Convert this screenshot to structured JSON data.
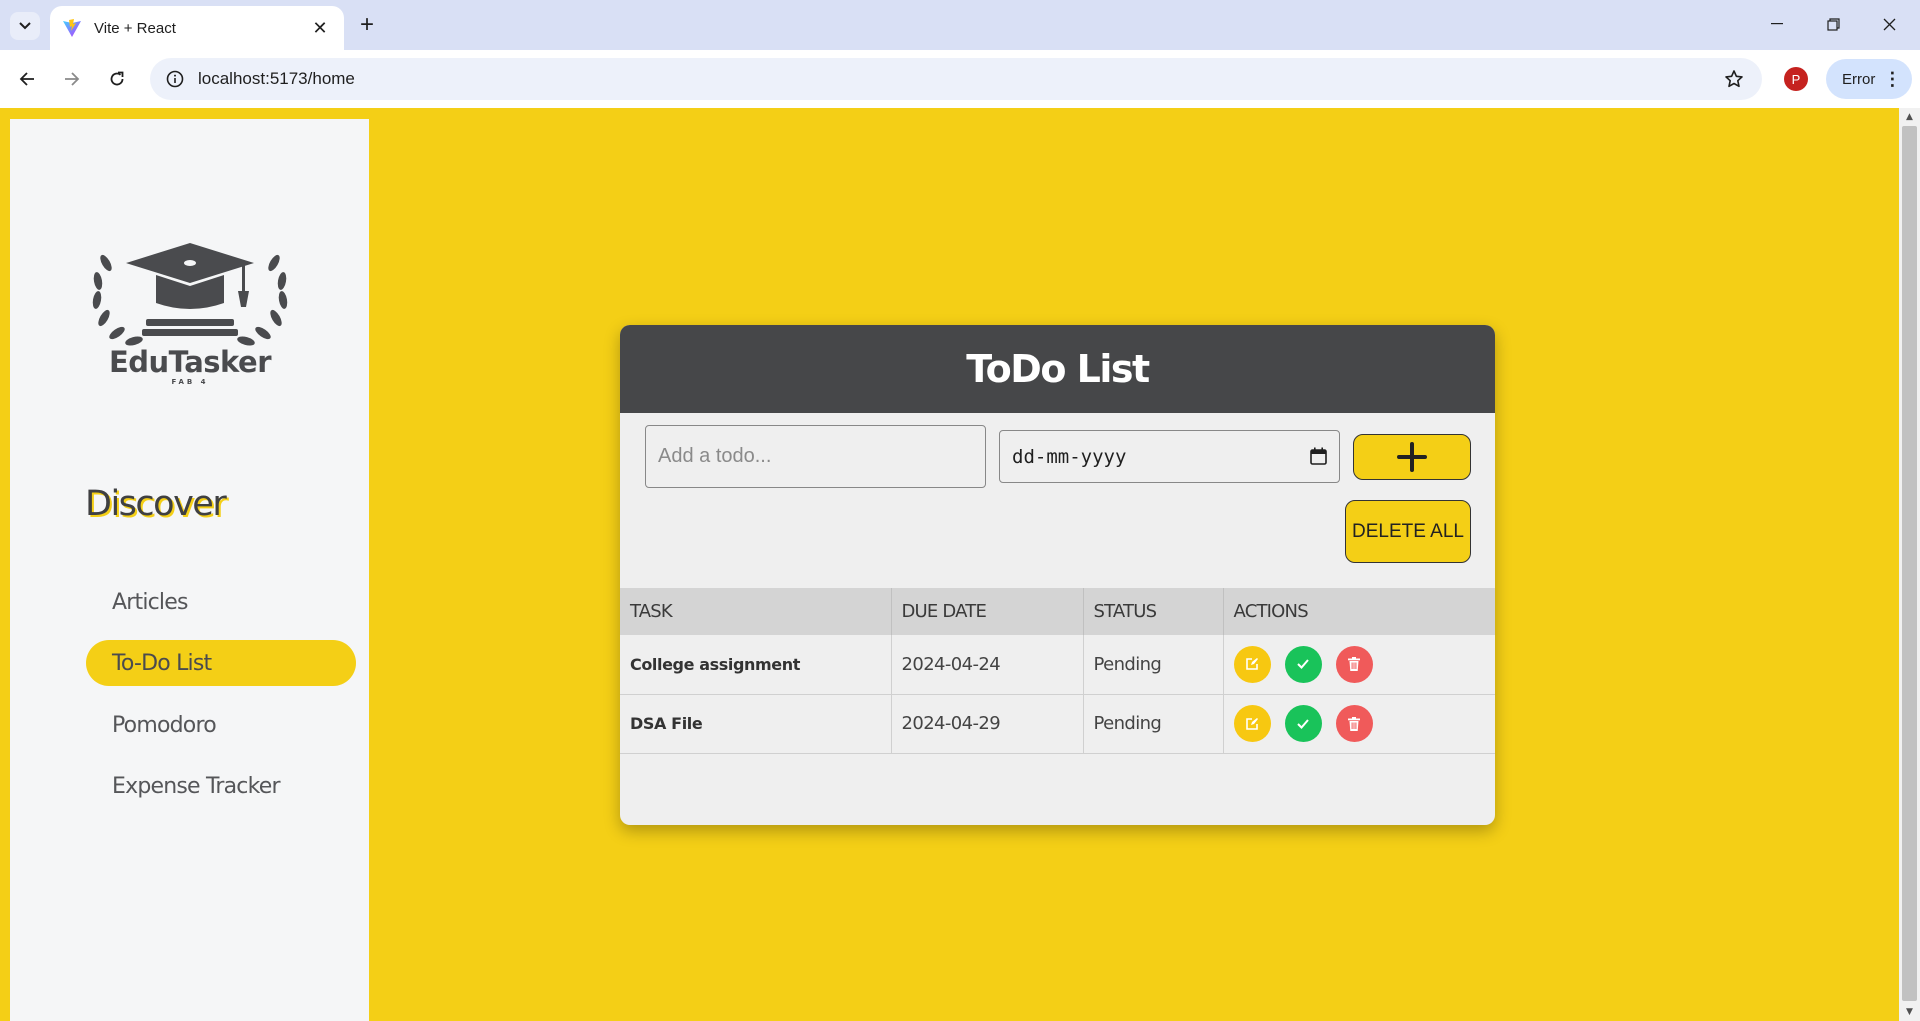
{
  "browser": {
    "tab_title": "Vite + React",
    "url": "localhost:5173/home",
    "profile_initial": "P",
    "error_label": "Error",
    "colors": {
      "tabbar": "#d9e0f5",
      "omnibox": "#edf1fa"
    }
  },
  "app": {
    "colors": {
      "accent": "#f4cf16",
      "header": "#464749",
      "sidebar": "#f5f6f7"
    },
    "logo": {
      "name": "EduTasker",
      "sub": "FAB 4"
    },
    "sidebar": {
      "heading": "Discover",
      "items": [
        {
          "label": "Articles",
          "active": false
        },
        {
          "label": "To-Do List",
          "active": true
        },
        {
          "label": "Pomodoro",
          "active": false
        },
        {
          "label": "Expense Tracker",
          "active": false
        }
      ]
    },
    "todo": {
      "title": "ToDo List",
      "input_placeholder": "Add a todo...",
      "date_placeholder": "dd-mm-yyyy",
      "delete_all_label": "DELETE ALL",
      "columns": [
        "TASK",
        "DUE DATE",
        "STATUS",
        "ACTIONS"
      ],
      "rows": [
        {
          "task": "College assignment",
          "due": "2024-04-24",
          "status": "Pending"
        },
        {
          "task": "DSA File",
          "due": "2024-04-29",
          "status": "Pending"
        }
      ],
      "action_icons": [
        "edit-icon",
        "check-icon",
        "trash-icon"
      ]
    }
  }
}
